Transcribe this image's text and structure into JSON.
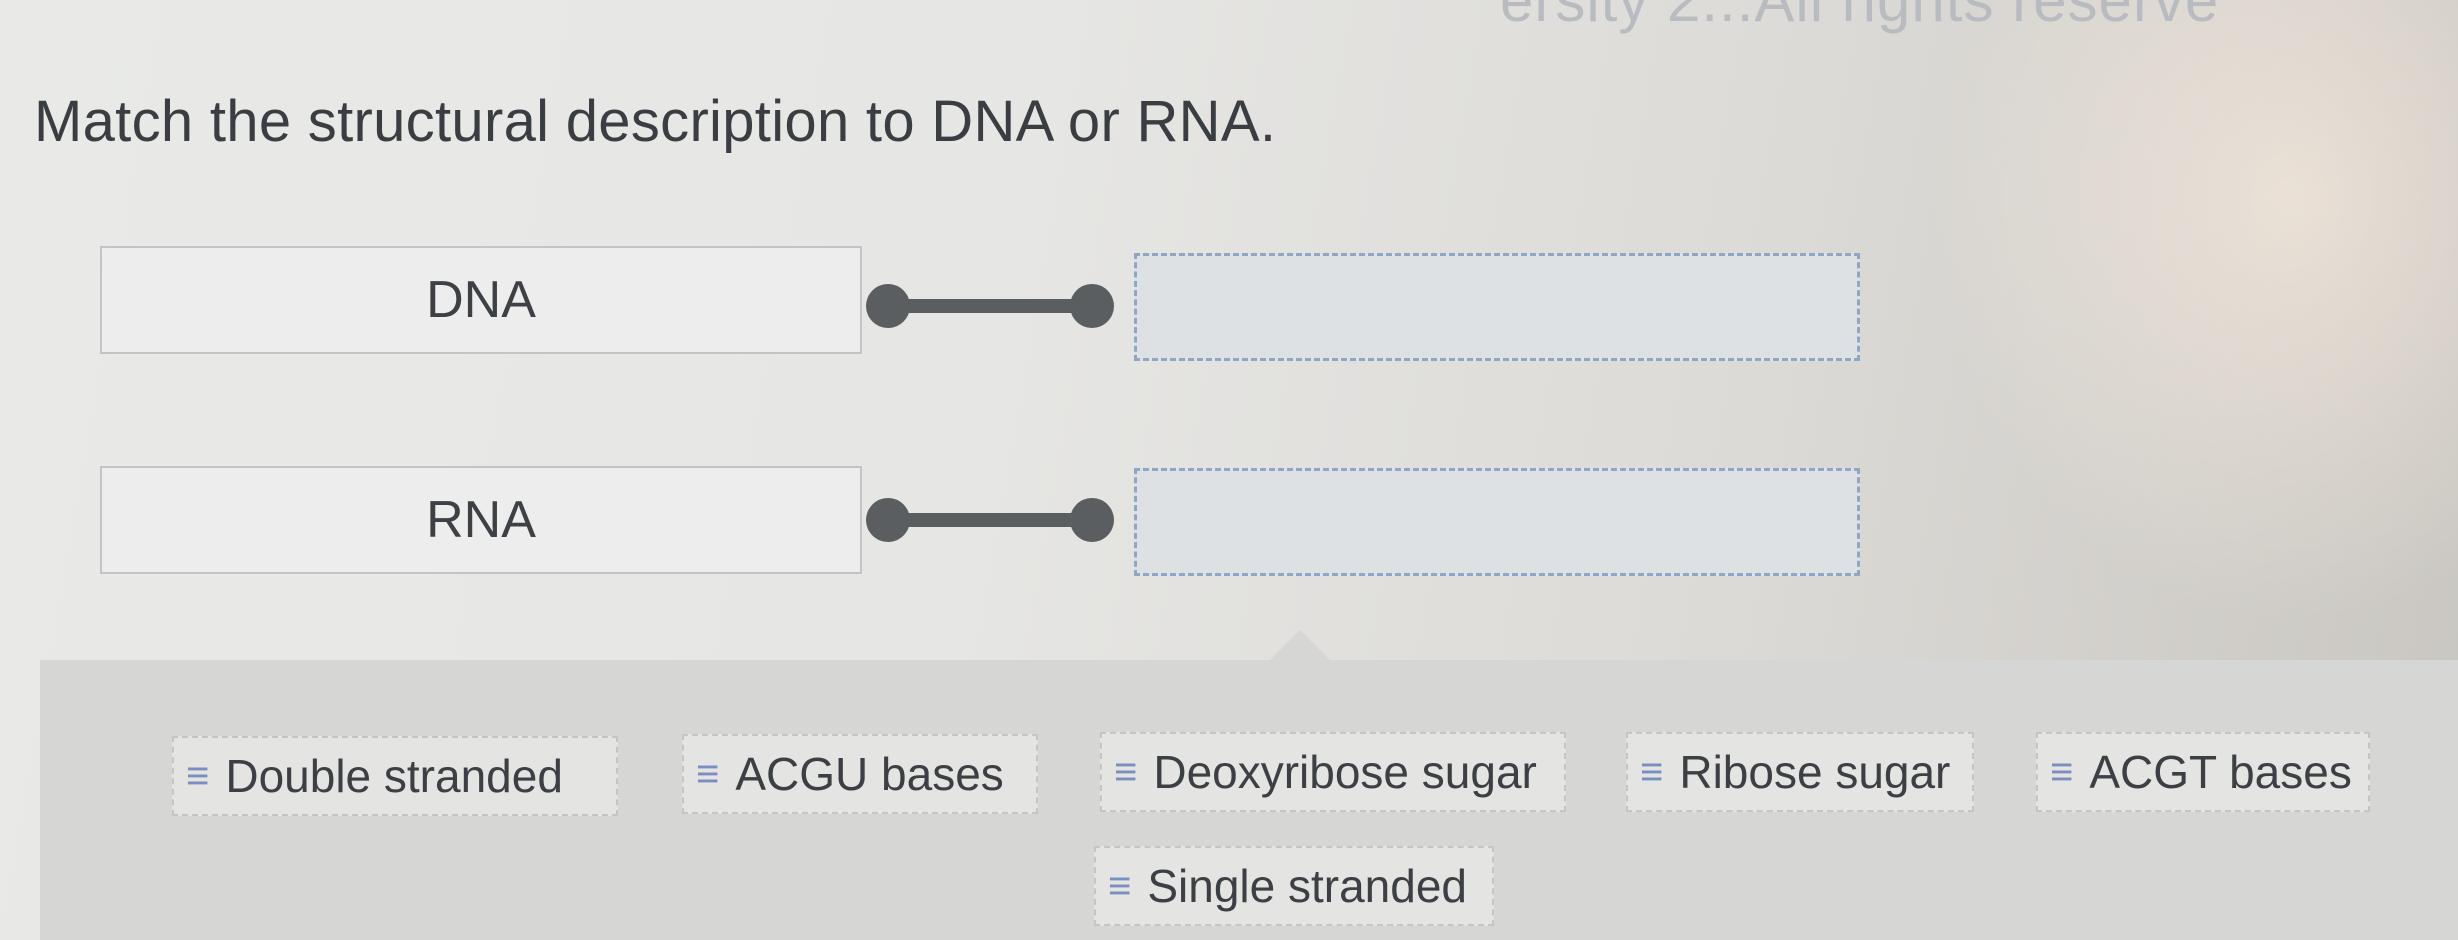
{
  "header": {
    "partial_text": "ersity 2...All rights reserve"
  },
  "question": {
    "prompt": "Match the structural description to DNA or RNA."
  },
  "terms": [
    {
      "label": "DNA"
    },
    {
      "label": "RNA"
    }
  ],
  "choices": [
    {
      "label": "Double stranded",
      "icon": "drag-handle-icon"
    },
    {
      "label": "ACGU bases",
      "icon": "drag-handle-icon"
    },
    {
      "label": "Deoxyribose sugar",
      "icon": "drag-handle-icon"
    },
    {
      "label": "Ribose sugar",
      "icon": "drag-handle-icon"
    },
    {
      "label": "ACGT bases",
      "icon": "drag-handle-icon"
    },
    {
      "label": "Single stranded",
      "icon": "drag-handle-icon"
    }
  ],
  "colors": {
    "connector": "#5b5e60",
    "drop_zone_border": "#8fa6c4",
    "drag_handle": "#7b8ec0"
  }
}
